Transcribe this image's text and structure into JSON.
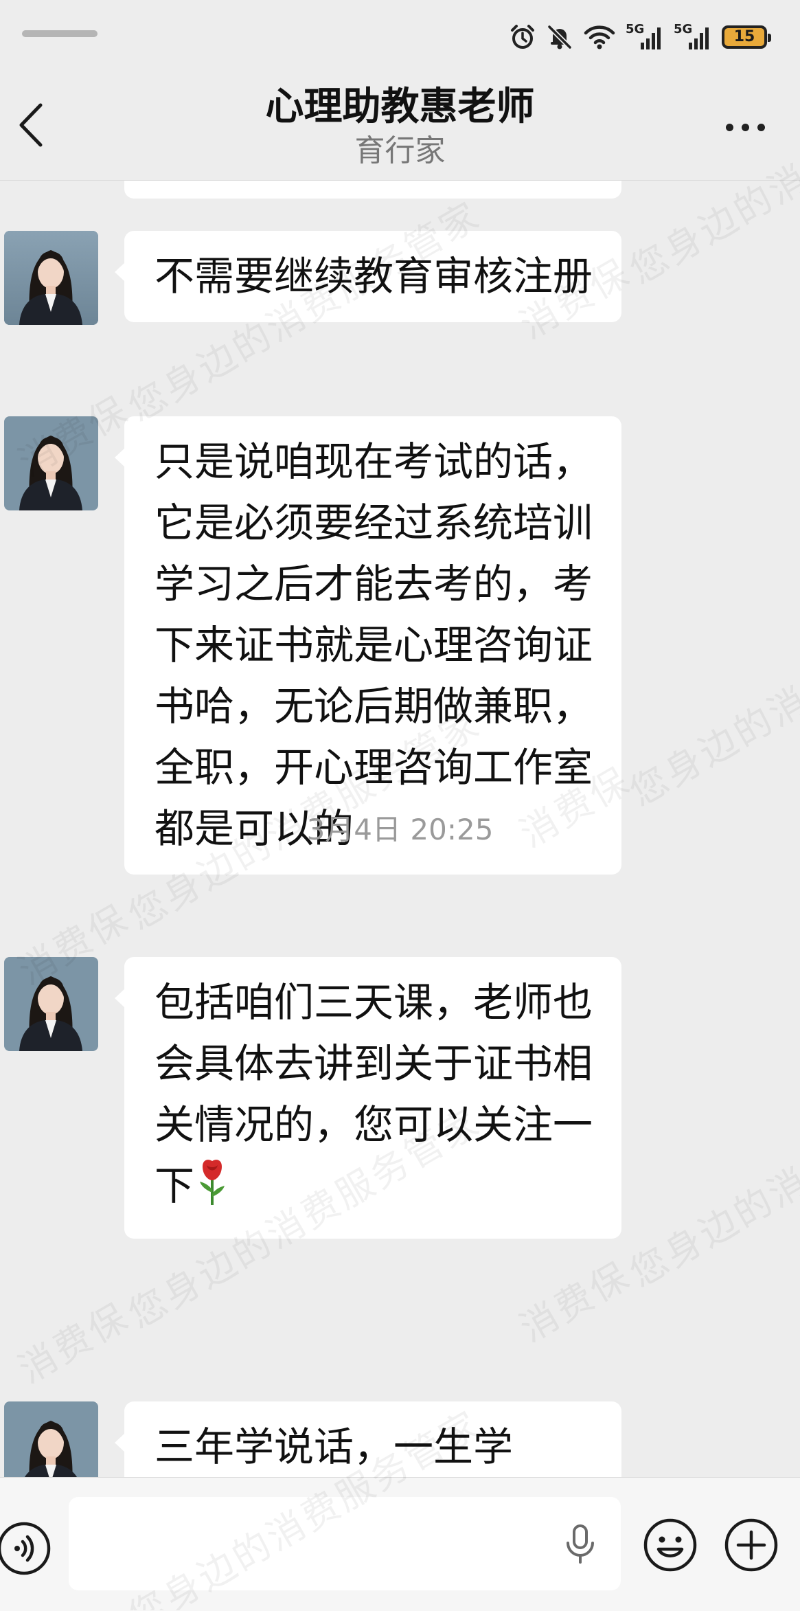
{
  "status_bar": {
    "battery_level": "15",
    "network_labels": [
      "5G",
      "5G"
    ]
  },
  "header": {
    "title": "心理助教惠老师",
    "subtitle": "育行家"
  },
  "messages": [
    {
      "sender": "惠老师",
      "text": "不需要继续教育审核注册"
    },
    {
      "sender": "惠老师",
      "text": "只是说咱现在考试的话，它是必须要经过系统培训学习之后才能去考的，考下来证书就是心理咨询证书哈，无论后期做兼职，全职，开心理咨询工作室都是可以的"
    },
    {
      "sender": "惠老师",
      "text": "包括咱们三天课，老师也会具体去讲到关于证书相关情况的，您可以关注一下",
      "trailing_emoji": "rose-icon"
    },
    {
      "sender": "惠老师",
      "text": "三年学说话，一生学"
    }
  ],
  "timestamp": "3月4日 20:25",
  "input": {
    "value": "",
    "placeholder": ""
  },
  "watermark": {
    "lines": [
      "消费保",
      "您身边的消费服务管家"
    ]
  },
  "colors": {
    "background": "#ededed",
    "bubble": "#ffffff",
    "battery": "#e8a93a",
    "subtitle": "#777777",
    "timestamp": "#9a9a9a"
  },
  "icons": [
    "back-arrow-icon",
    "more-icon",
    "alarm-icon",
    "mute-icon",
    "wifi-icon",
    "signal-icon",
    "battery-icon",
    "voice-icon",
    "mic-icon",
    "emoji-icon",
    "plus-icon",
    "rose-icon"
  ]
}
